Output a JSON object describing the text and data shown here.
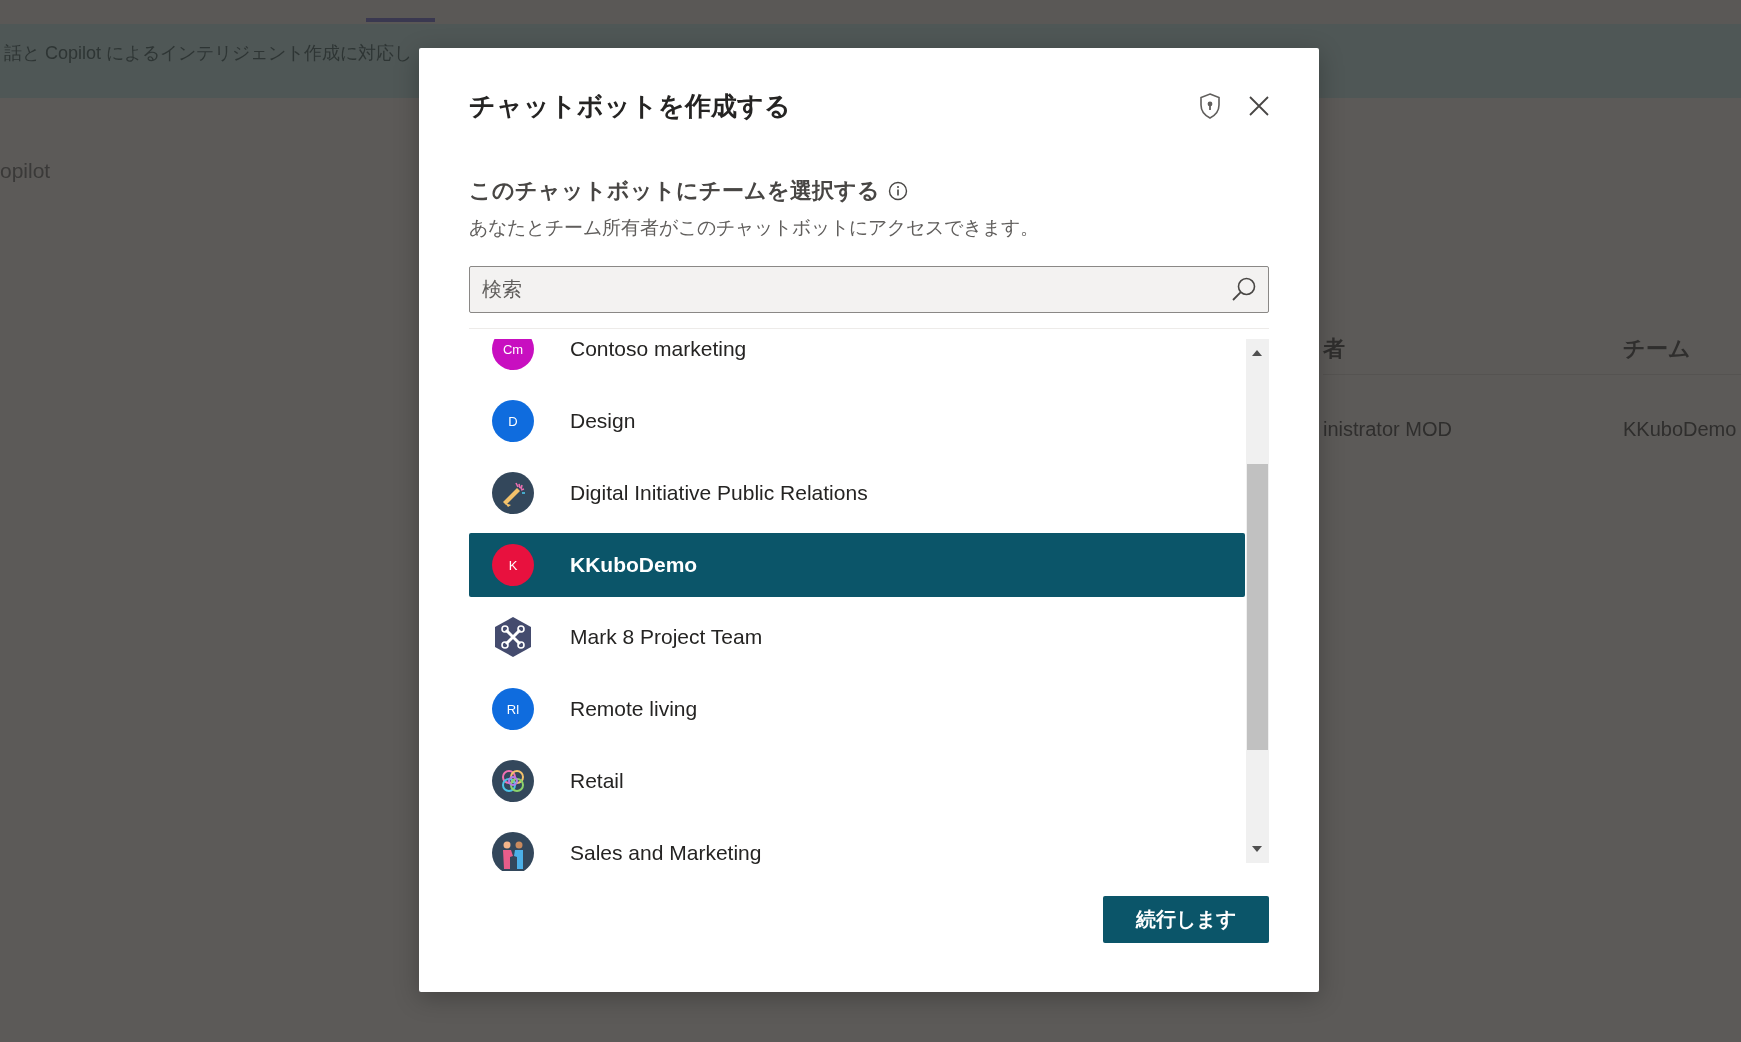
{
  "background": {
    "banner_text": "話と Copilot によるインテリジェント作成に対応し",
    "nav_text": "opilot",
    "table": {
      "columns": [
        "者",
        "チーム"
      ],
      "rows": [
        [
          "inistrator MOD",
          "KKuboDemo"
        ]
      ]
    }
  },
  "dialog": {
    "title": "チャットボットを作成する",
    "section_title": "このチャットボットにチームを選択する",
    "description": "あなたとチーム所有者がこのチャットボットにアクセスできます。",
    "search": {
      "placeholder": "検索"
    },
    "teams": [
      {
        "name": "Contoso marketing",
        "kind": "initials",
        "initials": "Cm",
        "color": "#c80fc0",
        "selected": false
      },
      {
        "name": "Design",
        "kind": "initials",
        "initials": "D",
        "color": "#0f6cde",
        "selected": false
      },
      {
        "name": "Digital Initiative Public Relations",
        "kind": "megaphone",
        "selected": false
      },
      {
        "name": "KKuboDemo",
        "kind": "initials",
        "initials": "K",
        "color": "#e8113e",
        "selected": true
      },
      {
        "name": "Mark 8 Project Team",
        "kind": "drone",
        "selected": false
      },
      {
        "name": "Remote living",
        "kind": "initials",
        "initials": "Rl",
        "color": "#0f6cde",
        "selected": false
      },
      {
        "name": "Retail",
        "kind": "knot",
        "selected": false
      },
      {
        "name": "Sales and Marketing",
        "kind": "people",
        "selected": false
      }
    ],
    "continue_button": "続行します"
  }
}
